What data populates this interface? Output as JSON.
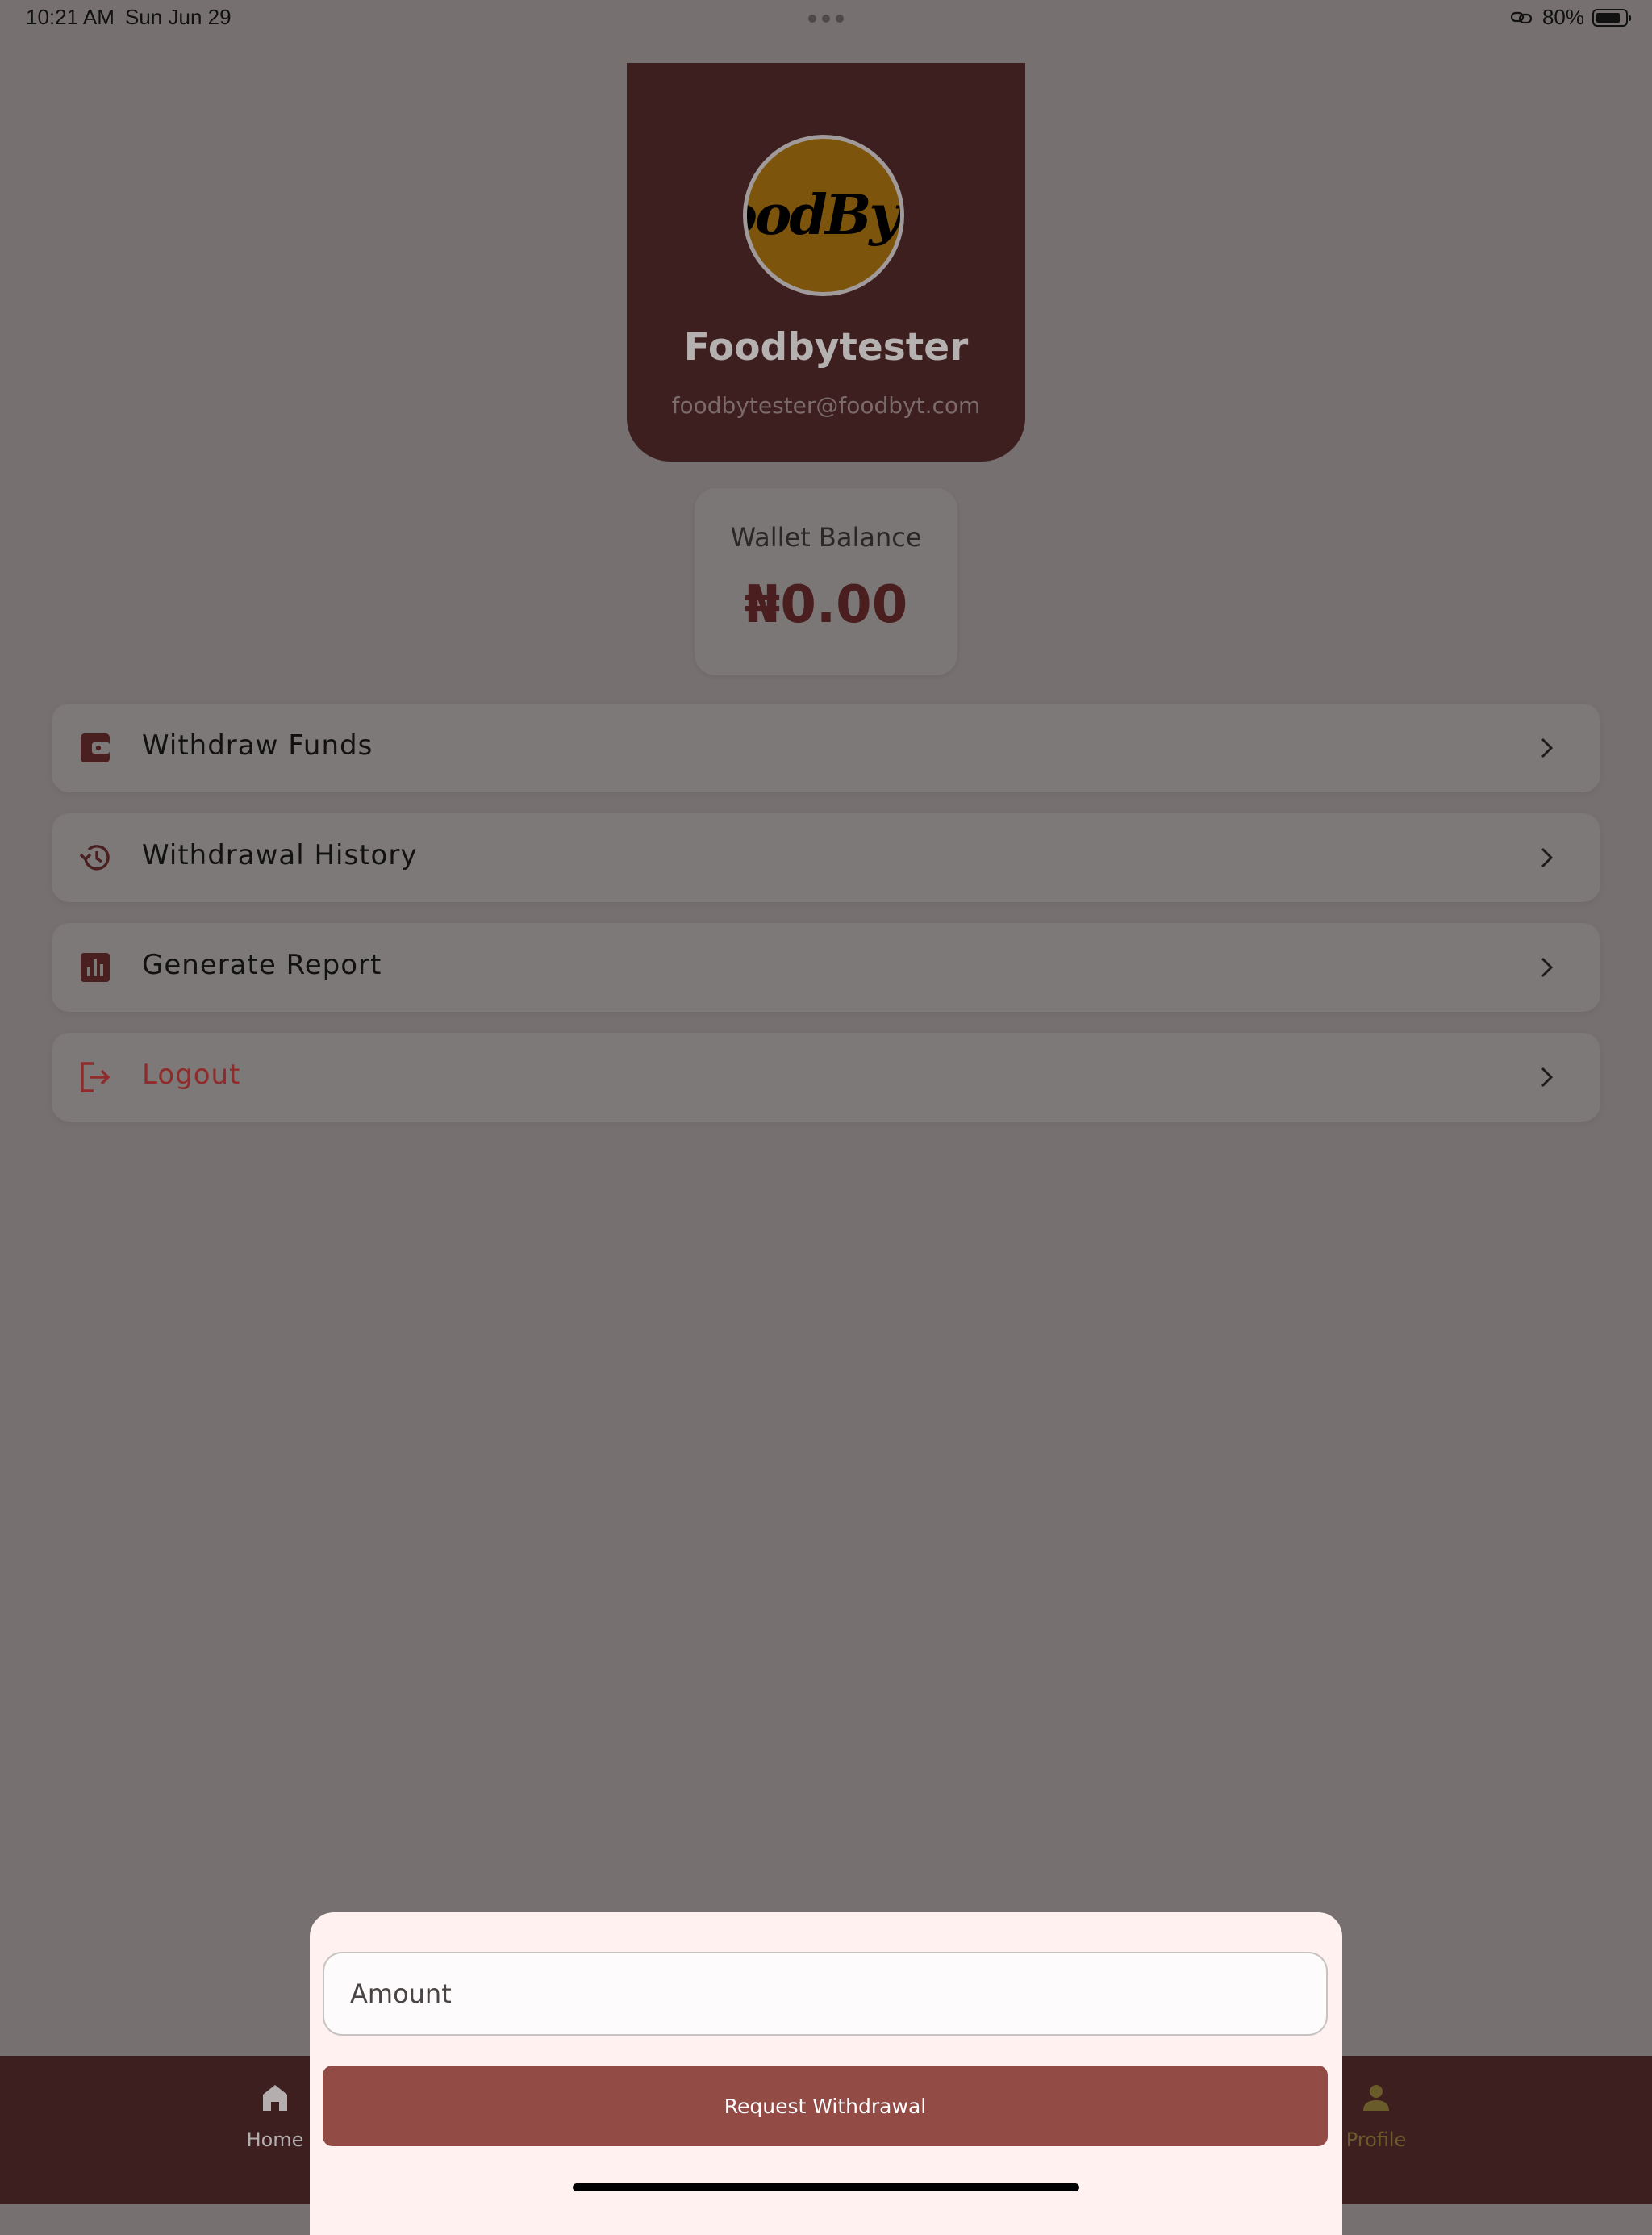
{
  "status_bar": {
    "time": "10:21 AM",
    "date": "Sun Jun 29",
    "battery": "80%"
  },
  "profile": {
    "logo_text": "oodByt",
    "name": "Foodbytester",
    "email": "foodbytester@foodbyt.com"
  },
  "wallet": {
    "label": "Wallet Balance",
    "amount": "₦0.00"
  },
  "menu": {
    "items": [
      {
        "label": "Withdraw Funds",
        "icon": "wallet-icon"
      },
      {
        "label": "Withdrawal History",
        "icon": "history-icon"
      },
      {
        "label": "Generate Report",
        "icon": "bar-chart-icon"
      },
      {
        "label": "Logout",
        "icon": "logout-icon"
      }
    ]
  },
  "bottom_nav": {
    "home_label": "Home",
    "profile_label": "Profile"
  },
  "sheet": {
    "amount_placeholder": "Amount",
    "button_label": "Request Withdrawal"
  },
  "colors": {
    "brand": "#3e1f1f",
    "accent": "#934b46",
    "logout": "#8f2b2b"
  }
}
